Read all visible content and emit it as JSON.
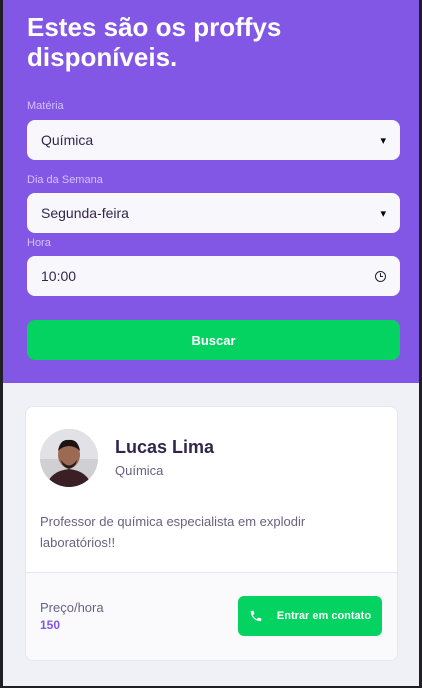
{
  "header": {
    "title": "Estes são os proffys disponíveis."
  },
  "filters": {
    "subject": {
      "label": "Matéria",
      "value": "Química"
    },
    "weekday": {
      "label": "Dia da Semana",
      "value": "Segunda-feira"
    },
    "time": {
      "label": "Hora",
      "value": "10:00"
    },
    "search_button": "Buscar"
  },
  "teacher": {
    "name": "Lucas Lima",
    "subject": "Química",
    "bio": "Professor de química especialista em explodir laboratórios!!",
    "price_label": "Preço/hora",
    "price_value": "150",
    "contact_button": "Entrar em contato"
  },
  "colors": {
    "primary": "#8257e5",
    "secondary": "#04d361",
    "background": "#f0f0f7",
    "text_title": "#32264d",
    "text_base": "#6a6180"
  },
  "icons": {
    "select_caret": "chevron-down-icon",
    "time_picker": "clock-icon",
    "contact": "whatsapp-icon"
  }
}
